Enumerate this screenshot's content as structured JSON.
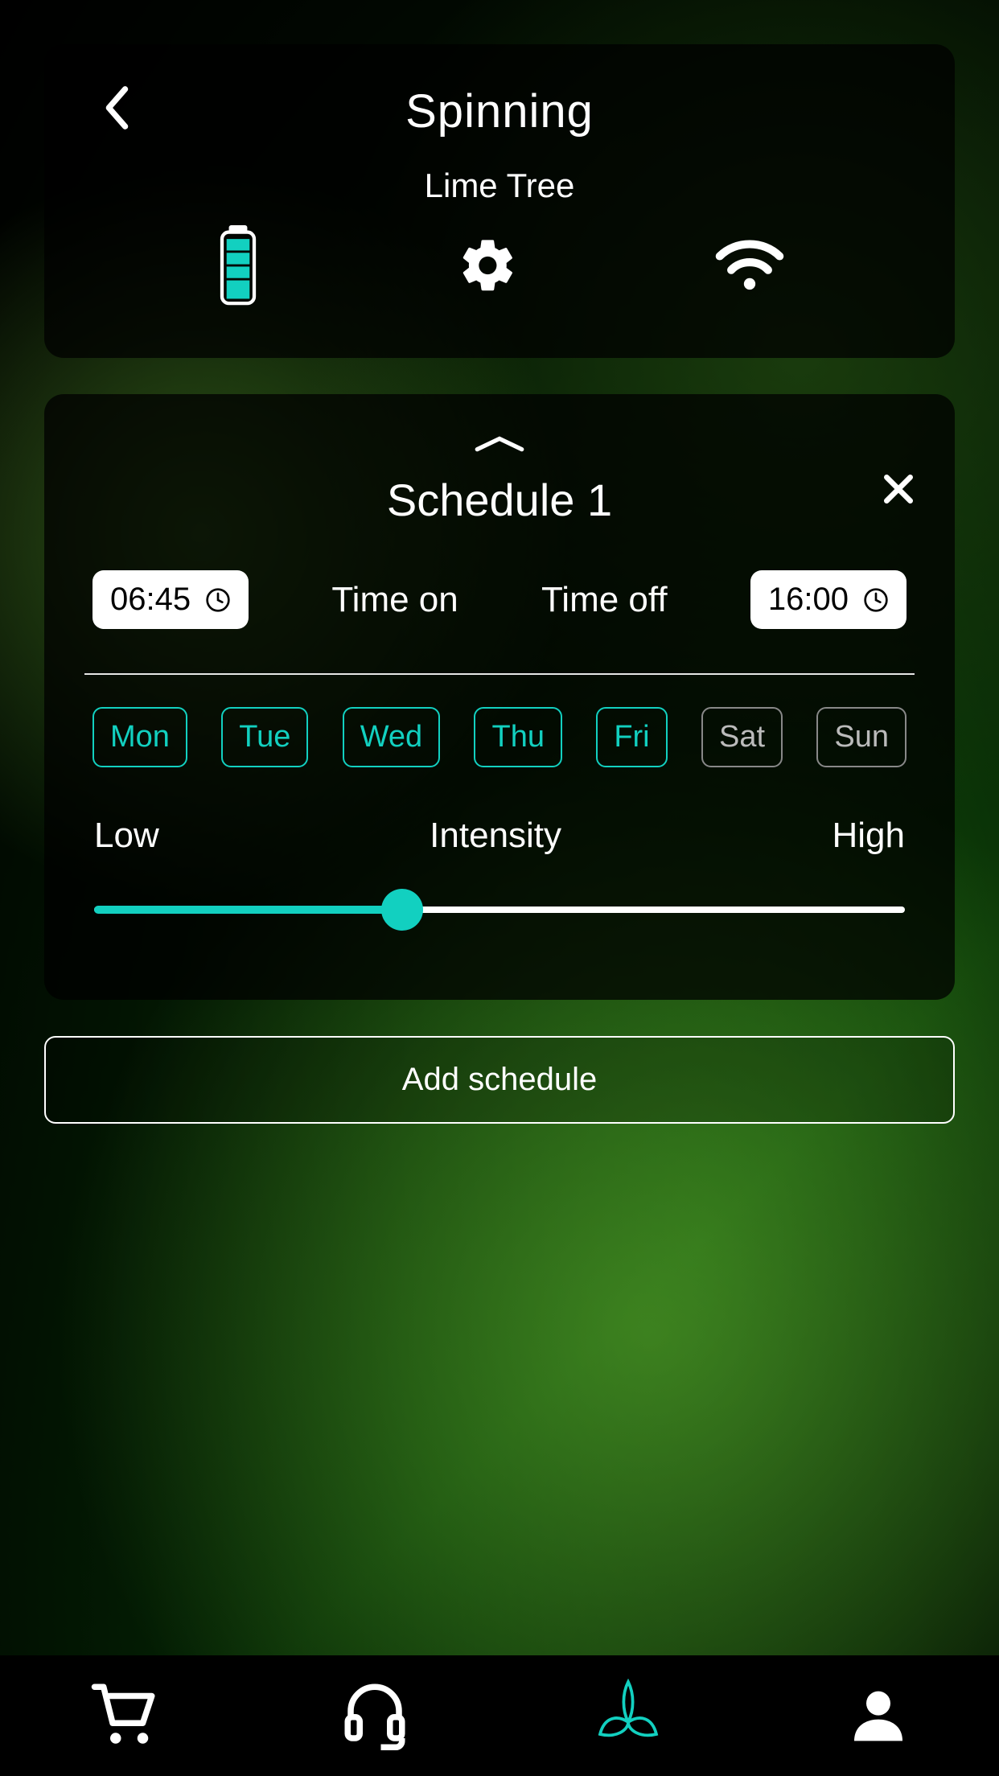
{
  "header": {
    "title": "Spinning",
    "subtitle": "Lime Tree"
  },
  "schedule": {
    "title": "Schedule 1",
    "time_on_label": "Time on",
    "time_off_label": "Time off",
    "time_on": "06:45",
    "time_off": "16:00",
    "days": [
      {
        "label": "Mon",
        "active": true
      },
      {
        "label": "Tue",
        "active": true
      },
      {
        "label": "Wed",
        "active": true
      },
      {
        "label": "Thu",
        "active": true
      },
      {
        "label": "Fri",
        "active": true
      },
      {
        "label": "Sat",
        "active": false
      },
      {
        "label": "Sun",
        "active": false
      }
    ],
    "intensity": {
      "low_label": "Low",
      "center_label": "Intensity",
      "high_label": "High",
      "value_percent": 38
    }
  },
  "actions": {
    "add_schedule": "Add schedule"
  },
  "colors": {
    "accent": "#12d0c0"
  }
}
